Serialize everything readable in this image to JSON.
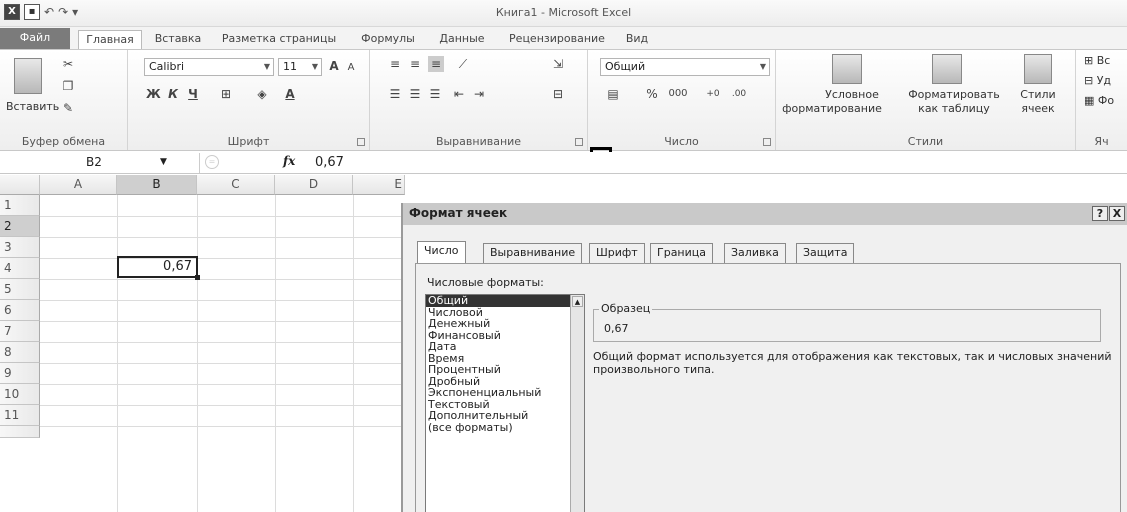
{
  "window": {
    "title": "Книга1 - Microsoft Excel",
    "excel_icon_letter": "X"
  },
  "tabs": [
    {
      "label": "Файл"
    },
    {
      "label": "Главная"
    },
    {
      "label": "Вставка"
    },
    {
      "label": "Разметка страницы"
    },
    {
      "label": "Формулы"
    },
    {
      "label": "Данные"
    },
    {
      "label": "Рецензирование"
    },
    {
      "label": "Вид"
    }
  ],
  "ribbon": {
    "clipboard": {
      "paste": "Вставить",
      "label": "Буфер обмена"
    },
    "font": {
      "name": "Calibri",
      "size": "11",
      "bold": "Ж",
      "italic": "К",
      "underline": "Ч",
      "label": "Шрифт"
    },
    "alignment": {
      "label": "Выравнивание"
    },
    "number": {
      "format": "Общий",
      "percent": "%",
      "thousands": "000",
      "label": "Число"
    },
    "styles": {
      "conditional_1": "Условное",
      "conditional_2": "форматирование",
      "table_1": "Форматировать",
      "table_2": "как таблицу",
      "cell_1": "Стили",
      "cell_2": "ячеек",
      "label": "Стили"
    },
    "cells": {
      "insert": "Вс",
      "delete": "Уд",
      "format": "Фо",
      "label": "Яч"
    }
  },
  "formula_bar": {
    "name_box": "B2",
    "fx": "fx",
    "value": "0,67"
  },
  "sheet": {
    "columns": [
      "A",
      "B",
      "C",
      "D",
      "E"
    ],
    "rows": [
      "1",
      "2",
      "3",
      "4",
      "5",
      "6",
      "7",
      "8",
      "9",
      "10",
      "11"
    ],
    "active_cell_value": "0,67"
  },
  "dialog": {
    "title": "Формат ячеек",
    "help": "?",
    "close": "X",
    "tabs": [
      "Число",
      "Выравнивание",
      "Шрифт",
      "Граница",
      "Заливка",
      "Защита"
    ],
    "category_label": "Числовые форматы:",
    "categories": [
      "Общий",
      "Числовой",
      "Денежный",
      "Финансовый",
      "Дата",
      "Время",
      "Процентный",
      "Дробный",
      "Экспоненциальный",
      "Текстовый",
      "Дополнительный",
      "(все форматы)"
    ],
    "sample_label": "Образец",
    "sample_value": "0,67",
    "description": "Общий формат используется для отображения как текстовых, так и числовых значений произвольного типа."
  }
}
